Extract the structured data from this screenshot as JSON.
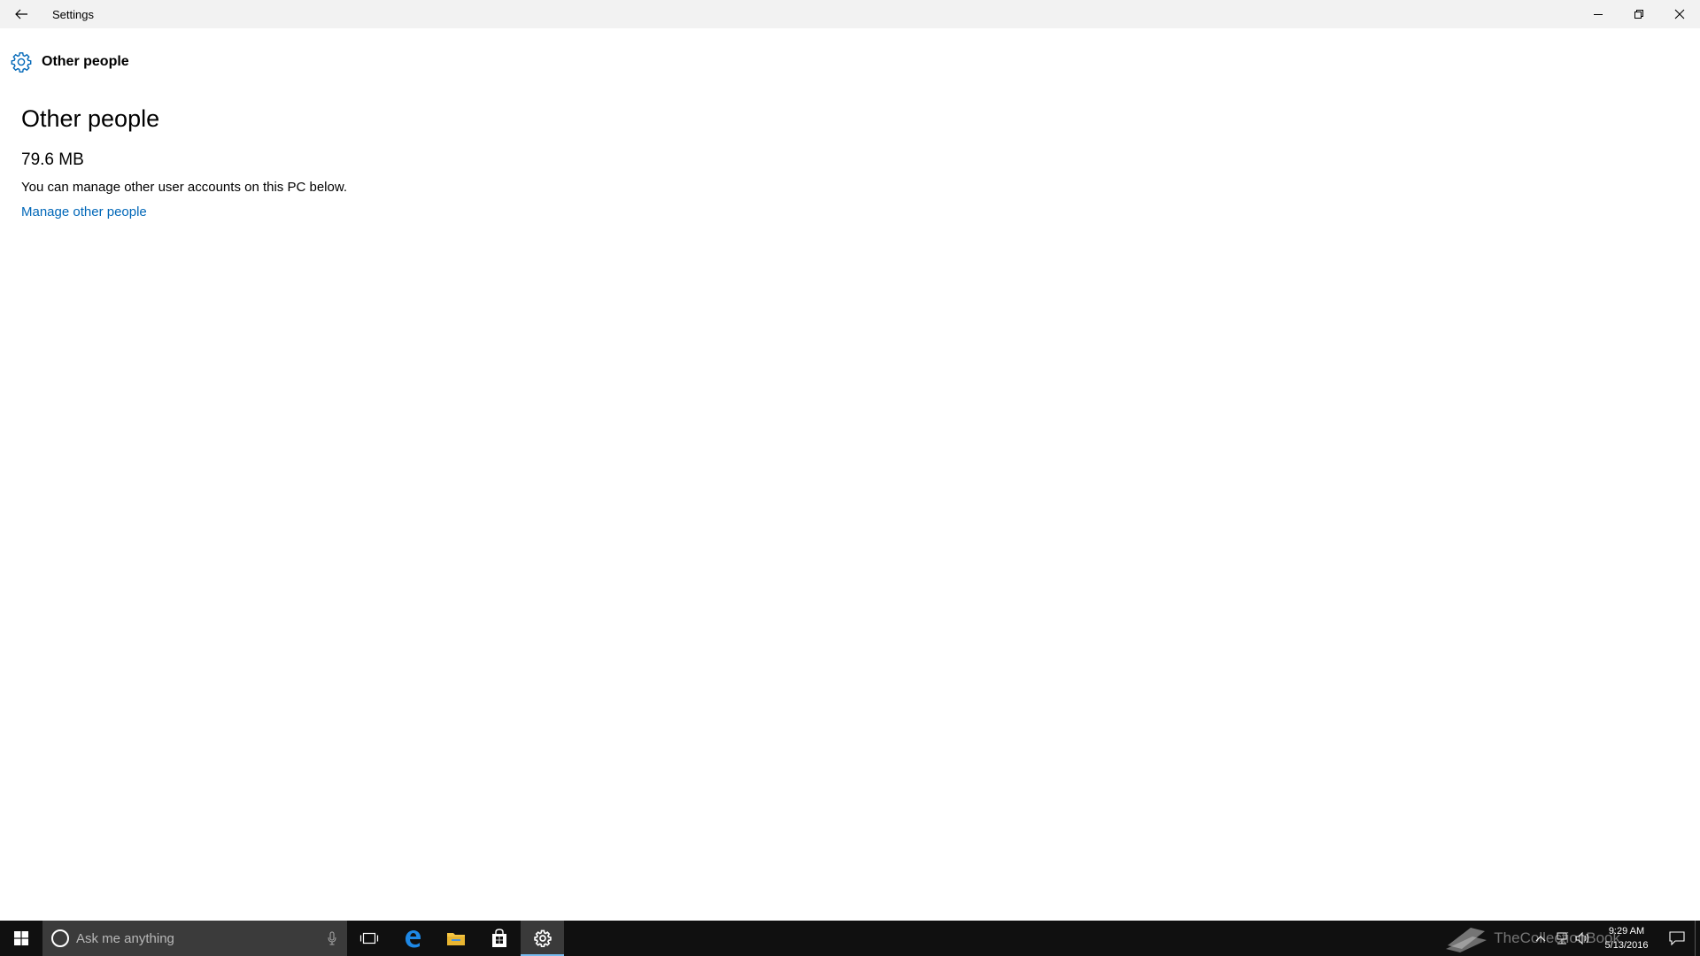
{
  "window": {
    "title": "Settings",
    "back_icon": "back-arrow-icon",
    "controls": [
      "minimize-icon",
      "restore-icon",
      "close-icon"
    ]
  },
  "header": {
    "icon": "gear-icon",
    "label": "Other people"
  },
  "main": {
    "title": "Other people",
    "size": "79.6 MB",
    "description": "You can manage other user accounts on this PC below.",
    "link_label": "Manage other people"
  },
  "taskbar": {
    "search_placeholder": "Ask me anything",
    "apps": [
      {
        "name": "task-view-icon",
        "active": false
      },
      {
        "name": "edge-icon",
        "active": false
      },
      {
        "name": "file-explorer-icon",
        "active": false
      },
      {
        "name": "store-icon",
        "active": false
      },
      {
        "name": "settings-icon",
        "active": true
      }
    ],
    "time": "9:29 AM",
    "date": "5/13/2016",
    "watermark": "TheCollectionBook"
  },
  "colors": {
    "accent": "#0067b8",
    "taskbar": "#101010",
    "search_box": "#3b3b3b",
    "titlebar": "#f2f2f2"
  }
}
